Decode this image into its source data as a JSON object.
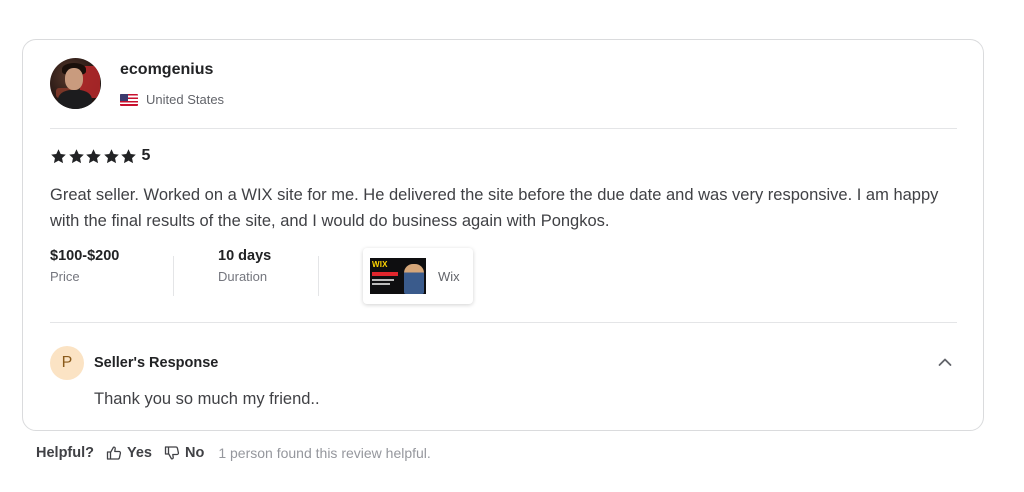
{
  "reviewer": {
    "username": "ecomgenius",
    "country": "United States"
  },
  "rating": {
    "stars": 5,
    "value": "5"
  },
  "review": {
    "text": "Great seller. Worked on a WIX site for me. He delivered the site before the due date and was very responsive. I am happy with the final results of the site, and I would do business again with Pongkos."
  },
  "meta": {
    "price_value": "$100-$200",
    "price_label": "Price",
    "duration_value": "10 days",
    "duration_label": "Duration",
    "gig_label": "Wix",
    "gig_thumb_text": "WIX"
  },
  "seller_response": {
    "avatar_letter": "P",
    "title": "Seller's Response",
    "text": "Thank you so much my friend.."
  },
  "footer": {
    "helpful_label": "Helpful?",
    "yes_label": "Yes",
    "no_label": "No",
    "found_text": "1 person found this review helpful."
  },
  "colors": {
    "star": "#222325",
    "response_avatar_bg": "#fbe3c4",
    "border": "#dadbdd"
  }
}
